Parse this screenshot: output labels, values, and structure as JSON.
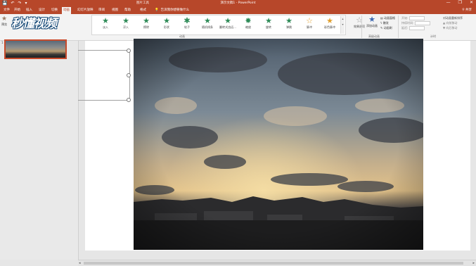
{
  "titlebar": {
    "qat": [
      "💾",
      "↶",
      "↷",
      "▾"
    ],
    "doc_title": "演示文稿1 - PowerPoint",
    "context_tool": "图片工具",
    "window_controls": [
      "—",
      "❐",
      "✕"
    ]
  },
  "tabs": [
    {
      "label": "文件"
    },
    {
      "label": "开始"
    },
    {
      "label": "插入"
    },
    {
      "label": "设计"
    },
    {
      "label": "切换"
    },
    {
      "label": "动画"
    },
    {
      "label": "幻灯片放映"
    },
    {
      "label": "审阅"
    },
    {
      "label": "视图"
    },
    {
      "label": "帮助"
    },
    {
      "label": "格式"
    }
  ],
  "tell_me": "告诉我你想要做什么",
  "user_label": "共享",
  "ribbon": {
    "preview_label": "预览",
    "animations": [
      {
        "label": "淡入"
      },
      {
        "label": "浮入"
      },
      {
        "label": "擦除"
      },
      {
        "label": "形状"
      },
      {
        "label": "轮子"
      },
      {
        "label": "随机线条"
      },
      {
        "label": "翻转式由远..."
      },
      {
        "label": "缩放"
      },
      {
        "label": "旋转"
      },
      {
        "label": "弹跳"
      },
      {
        "label": "脉冲"
      },
      {
        "label": "彩色脉冲"
      },
      {
        "label": "效果选项"
      }
    ],
    "group_animation": "动画",
    "add_animation": "添加动画",
    "animation_pane": "动画窗格",
    "trigger": "触发",
    "painter": "动画刷",
    "group_advanced": "高级动画",
    "start_label": "开始:",
    "duration_label": "持续时间:",
    "delay_label": "延迟:",
    "reorder_title": "对动画重新排序",
    "move_earlier": "向前移动",
    "move_later": "向后移动",
    "group_timing": "计时"
  },
  "thumbnails": {
    "slide_number": "1"
  },
  "watermark": "秒懂视频",
  "colors": {
    "accent": "#b7472a",
    "ribbon_bg": "#f3f3f3",
    "selection": "#c84b2c"
  }
}
